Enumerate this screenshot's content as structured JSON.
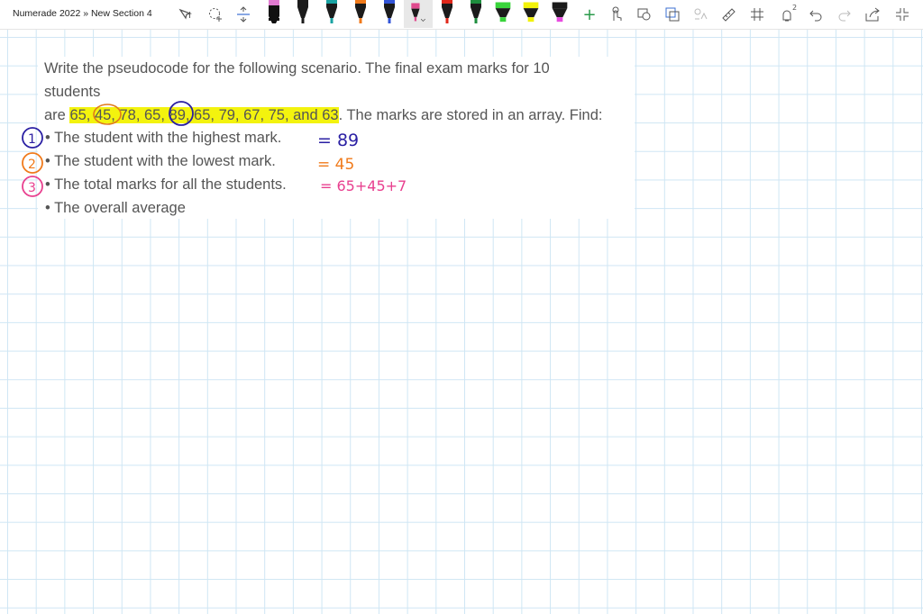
{
  "header": {
    "breadcrumb": "Numerade 2022 » New Section 4",
    "superscript_badge": "2"
  },
  "toolbar": {
    "pens": [
      {
        "name": "pen-black",
        "color": "#111111",
        "band": "#e07ad0"
      },
      {
        "name": "pen-dark",
        "color": "#1b1b1b",
        "band": "#1b1b1b"
      },
      {
        "name": "pen-teal",
        "color": "#1b1b1b",
        "band": "#1aa3a3"
      },
      {
        "name": "pen-orange",
        "color": "#1b1b1b",
        "band": "#f07a1b"
      },
      {
        "name": "pen-blue",
        "color": "#1b1b1b",
        "band": "#3355d8"
      },
      {
        "name": "pen-pink",
        "color": "#1b1b1b",
        "band": "#e04a8e"
      },
      {
        "name": "pen-red",
        "color": "#1b1b1b",
        "band": "#e0281b"
      },
      {
        "name": "pen-green",
        "color": "#1b1b1b",
        "band": "#1e8e3e"
      },
      {
        "name": "highlighter-green",
        "color": "#1b1b1b",
        "band": "#39d43b"
      },
      {
        "name": "highlighter-yellow",
        "color": "#1b1b1b",
        "band": "#f2f20a"
      },
      {
        "name": "highlighter-magenta",
        "color": "#1b1b1b",
        "band": "#e84ae0"
      }
    ]
  },
  "problem": {
    "line1": "Write the pseudocode for the following scenario. The final exam marks for 10",
    "line2": "students",
    "line3_prefix": "are ",
    "line3_highlight": "65, 45, 78, 65, 89, 65, 79, 67, 75, and 63",
    "line3_suffix": ". The marks are stored in an array. Find:",
    "bullets": [
      "• The student with the highest mark.",
      "• The student with the lowest mark.",
      "• The total marks for all the students.",
      "• The overall average"
    ]
  },
  "annotations": {
    "numbers": [
      "1",
      "2",
      "3"
    ],
    "answers": [
      "= 89",
      "= 45",
      "= 65+45+7"
    ],
    "colors": {
      "purple": "#2a1fa3",
      "orange": "#f07a1b",
      "pink": "#e8408f"
    }
  }
}
